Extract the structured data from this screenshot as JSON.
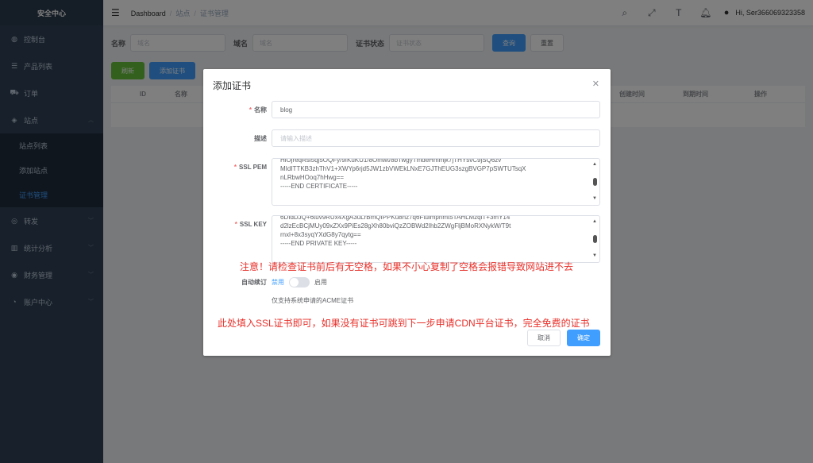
{
  "sidebar": {
    "logo": "安全中心",
    "items": [
      {
        "label": "控制台",
        "icon": "dashboard-icon",
        "glyph": "◍"
      },
      {
        "label": "产品列表",
        "icon": "product-icon",
        "glyph": "☰"
      },
      {
        "label": "订单",
        "icon": "cart-icon",
        "glyph": "⛟"
      },
      {
        "label": "站点",
        "icon": "site-icon",
        "glyph": "◈"
      }
    ],
    "sub_items": [
      {
        "label": "站点列表"
      },
      {
        "label": "添加站点"
      },
      {
        "label": "证书管理"
      }
    ],
    "items2": [
      {
        "label": "转发",
        "icon": "forward-icon",
        "glyph": "◎"
      },
      {
        "label": "统计分析",
        "icon": "stats-icon",
        "glyph": "▥"
      },
      {
        "label": "财务管理",
        "icon": "finance-icon",
        "glyph": "◉"
      },
      {
        "label": "账户中心",
        "icon": "account-icon",
        "glyph": "◔"
      }
    ]
  },
  "header": {
    "breadcrumb": [
      "Dashboard",
      "站点",
      "证书管理"
    ],
    "user": "Hi, Ser366069323358"
  },
  "filters": {
    "name_label": "名称",
    "name_placeholder": "域名",
    "domain_label": "域名",
    "domain_placeholder": "域名",
    "status_label": "证书状态",
    "status_placeholder": "证书状态",
    "search": "查询",
    "reset": "重置"
  },
  "actions": {
    "refresh": "刷新",
    "add": "添加证书"
  },
  "table": {
    "columns": [
      "ID",
      "名称",
      "创建时间",
      "到期时间",
      "操作"
    ]
  },
  "dialog": {
    "title": "添加证书",
    "name_label": "名称",
    "name_value": "blog",
    "desc_label": "描述",
    "desc_placeholder": "请输入描述",
    "pem_label": "SSL PEM",
    "pem_lines": [
      "HiOjreqRsl5qj5OQFy/9fKuKU1/8Omwt/8bTwgyTmdeHmmjk7jTHYsvC9jSQ6zv",
      "MIdITTKB3zhThV1+XWYp6rjd5JW1zbVWEkLNxE7GJThEUG3szgBVGP7pSWTUTsqX",
      "nLRbwHOoq7hHwg==",
      "-----END CERTIFICATE-----"
    ],
    "key_label": "SSL KEY",
    "key_lines": [
      "6DIdDJQ+6tuv9RUx4XgA3uLrBmQfPPKu8hz7q6Ftuimpnmt5TAHLMzqiT+3mY14",
      "d2lzEcBCjMUy09xZXx9PiEs28gXh80bviQzZOBWd2Ihb2ZWgFljBMoRXNykW/T9t",
      "rnxl+8x3syqYXdG8y7qytg==",
      "-----END PRIVATE KEY-----"
    ],
    "auto_label": "自动续订",
    "auto_off": "禁用",
    "auto_on": "启用",
    "hint": "仅支持系统申请的ACME证书",
    "cancel": "取消",
    "confirm": "确定"
  },
  "annotations": {
    "warning": "注意！请检查证书前后有无空格，如果不小心复制了空格会报错导致网站进不去",
    "info": "此处填入SSL证书即可，如果没有证书可跳到下一步申请CDN平台证书，完全免费的证书"
  }
}
